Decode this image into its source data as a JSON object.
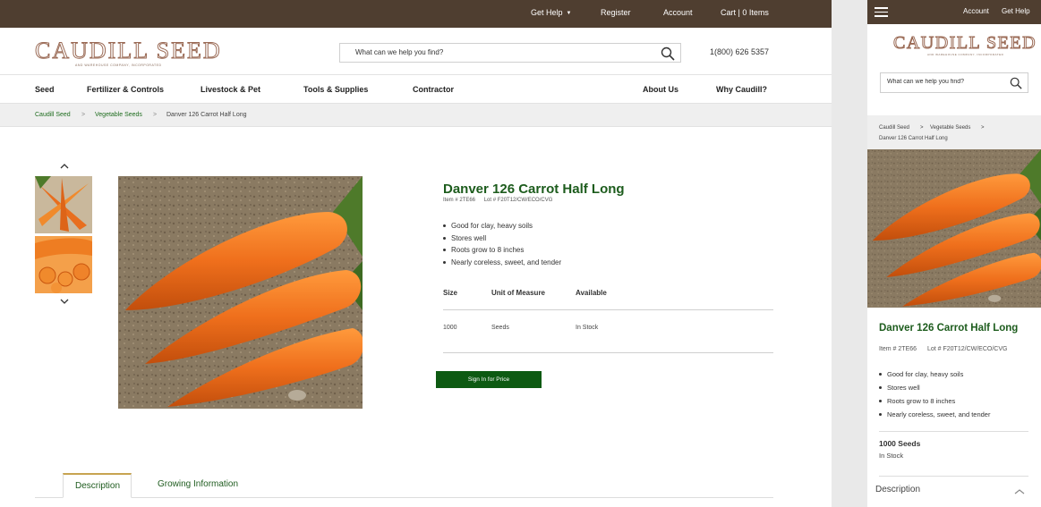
{
  "brand": {
    "logo_text": "CAUDILL SEED",
    "logo_tagline": "AND WAREHOUSE COMPANY, INCORPORATED"
  },
  "topbar": {
    "get_help": "Get Help",
    "register": "Register",
    "account": "Account",
    "cart": "Cart | 0 Items"
  },
  "header": {
    "search_placeholder": "What can we help you find?",
    "phone": "1(800) 626 5357"
  },
  "nav": {
    "items": [
      "Seed",
      "Fertilizer & Controls",
      "Livestock & Pet",
      "Tools & Supplies",
      "Contractor",
      "About Us",
      "Why Caudill?"
    ]
  },
  "breadcrumb": {
    "items": [
      "Caudill Seed",
      "Vegetable Seeds",
      "Danver 126 Carrot Half Long"
    ],
    "separator": ">"
  },
  "product": {
    "title": "Danver 126 Carrot Half Long",
    "item_no": "Item # 2TE66",
    "lot_no": "Lot # F20T12/CW/ECO/CVG",
    "features": [
      "Good for clay, heavy soils",
      "Stores well",
      "Roots grow to 8 inches",
      "Nearly coreless, sweet, and tender"
    ],
    "table": {
      "headers": [
        "Size",
        "Unit of Measure",
        "Available"
      ],
      "rows": [
        [
          "1000",
          "Seeds",
          "In Stock"
        ]
      ]
    },
    "sign_in_label": "Sign In for Price"
  },
  "tabs": [
    "Description",
    "Growing Information"
  ],
  "mobile": {
    "account": "Account",
    "get_help": "Get Help",
    "search_placeholder": "What can we help you find?",
    "breadcrumb": [
      "Caudill Seed",
      "Vegetable Seeds",
      "Danver 126 Carrot Half Long"
    ],
    "variant": "1000 Seeds",
    "stock": "In Stock",
    "accordion_label": "Description"
  },
  "colors": {
    "topbar_bg": "#4f3e30",
    "title_green": "#1d5c1d",
    "button_green": "#0d5a12",
    "tab_accent": "#c7a451",
    "carrot_orange": "#ee7d22"
  },
  "icons": {
    "search": "search-icon",
    "menu": "hamburger-icon",
    "thumb_up": "chevron-up-icon",
    "thumb_down": "chevron-down-icon",
    "accordion": "chevron-up-icon"
  }
}
